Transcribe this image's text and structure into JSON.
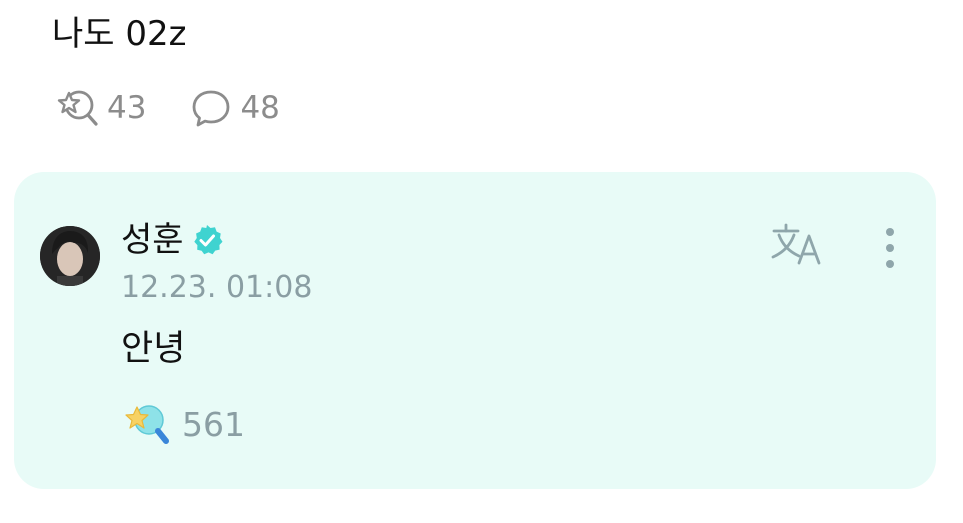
{
  "post": {
    "text": "나도 02z",
    "like_count": "43",
    "comment_count": "48"
  },
  "comment": {
    "author": "성훈",
    "timestamp": "12.23. 01:08",
    "text": "안녕",
    "like_count": "561"
  },
  "colors": {
    "card_bg": "#e8fbf7",
    "verified": "#3fd3d0",
    "muted_text": "#8a9ea3"
  },
  "icons": {
    "like": "star-search-icon",
    "comment": "speech-bubble-icon",
    "verified": "verified-badge-icon",
    "translate": "translate-icon",
    "more": "more-vertical-icon",
    "comment_like": "star-search-filled-icon"
  }
}
